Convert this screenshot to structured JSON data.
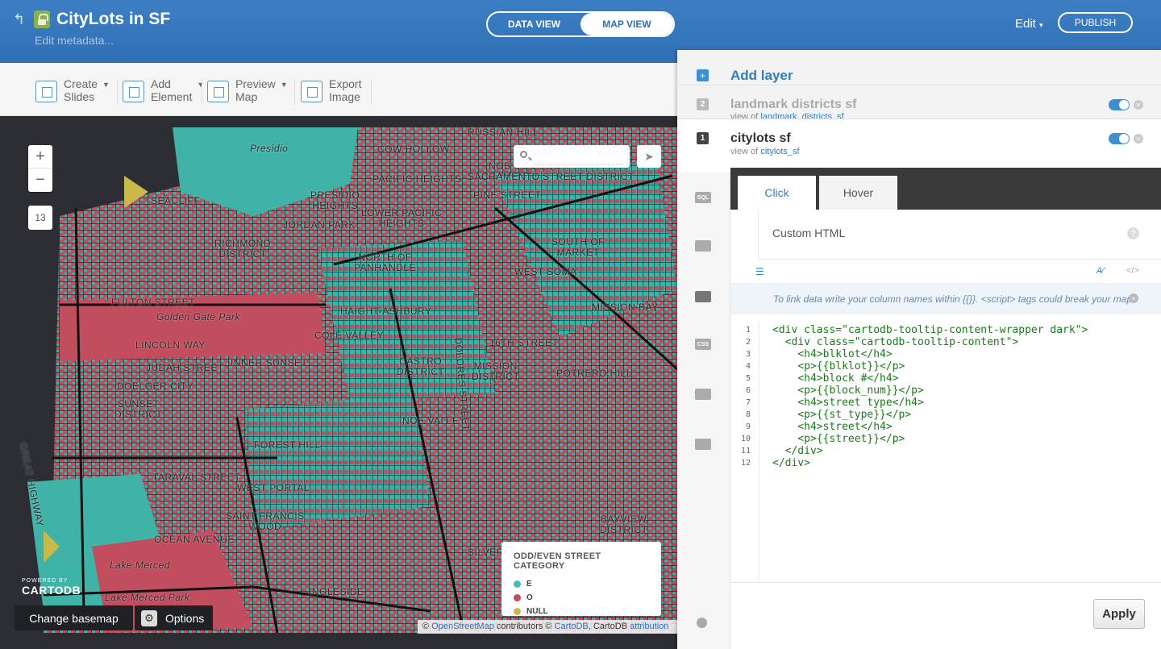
{
  "header": {
    "title": "CityLots in SF",
    "subtitle": "Edit metadata...",
    "data_view": "DATA VIEW",
    "map_view": "MAP VIEW",
    "edit": "Edit",
    "publish": "PUBLISH"
  },
  "toolbar": {
    "items": [
      {
        "line1": "Create",
        "line2": "Slides"
      },
      {
        "line1": "Add",
        "line2": "Element"
      },
      {
        "line1": "Preview",
        "line2": "Map"
      },
      {
        "line1": "Export",
        "line2": "Image"
      }
    ]
  },
  "map": {
    "zoom_in": "+",
    "zoom_out": "−",
    "zoom_level": "13",
    "search_placeholder": "",
    "labels": [
      "RUSSIAN HILL",
      "Presidio",
      "COW HOLLOW",
      "NOB",
      "PACIFIC HEIGHTS",
      "SACRAMENTO STREET DISTRICT",
      "SEACLIFF",
      "PRESIDIO\nHEIGHTS",
      "PINE STREET",
      "LOWER PACIFIC\nHEIGHTS",
      "JORDAN PARK",
      "RICHMOND\nDISTRICT",
      "SOUTH OF\nMARKET",
      "NORTH OF\nPANHANDLE",
      "WEST SOMA",
      "MISSION BAY",
      "FULTON STREET",
      "HAIGHT-ASHBURY",
      "Golden Gate Park",
      "COLE VALLEY",
      "LINCOLN WAY",
      "16TH STREET",
      "CASTRO\nDISTRICT",
      "MISSION\nDISTRICT",
      "INNER SUNSET",
      "JUDAH STREET",
      "POTRERO HILL",
      "DOELGER CITY",
      "SUNSET\nDISTRICT",
      "NOE VALLEY",
      "FOREST HILL",
      "TARAVAL STREET",
      "WEST PORTAL",
      "SAINT FRANCIS\nWOOD",
      "OCEAN AVENUE",
      "BAYVIEW\nDISTRICT",
      "Lake Merced",
      "SILVER",
      "INGLESIDE",
      "Lake Merced Park",
      "GREAT HIGHWAY",
      "DOLORES STREET"
    ],
    "powered_by": "POWERED BY",
    "brand": "CARTODB",
    "change_basemap": "Change basemap",
    "options": "Options",
    "legend": {
      "title": "ODD/EVEN STREET CATEGORY",
      "items": [
        {
          "label": "E",
          "color": "#3cc0b4"
        },
        {
          "label": "O",
          "color": "#c9475a"
        },
        {
          "label": "NULL",
          "color": "#c9b84a"
        }
      ]
    },
    "attribution": {
      "prefix": "©",
      "osm": "OpenStreetMap",
      "mid": "contributors ©",
      "cartodb": "CartoDB",
      "mid2": ", CartoDB",
      "attr": "attribution"
    }
  },
  "panel": {
    "add_layer": "Add layer",
    "layers": [
      {
        "num": "2",
        "name": "landmark districts sf",
        "view_of": "view of",
        "table": "landmark_districts_sf"
      },
      {
        "num": "1",
        "name": "citylots sf",
        "view_of": "view of",
        "table": "citylots_sf"
      }
    ],
    "side_tools": [
      "SQL",
      "",
      "",
      "CSS",
      "",
      ""
    ],
    "tabs": [
      "Click",
      "Hover"
    ],
    "custom_html": "Custom HTML",
    "hint": "To link data write your column names within {{}}. <script> tags could break your map.",
    "code_lines": [
      "<div class=\"cartodb-tooltip-content-wrapper dark\">",
      "  <div class=\"cartodb-tooltip-content\">",
      "    <h4>blklot</h4>",
      "    <p>{{blklot}}</p>",
      "    <h4>block #</h4>",
      "    <p>{{block_num}}</p>",
      "    <h4>street type</h4>",
      "    <p>{{st_type}}</p>",
      "    <h4>street</h4>",
      "    <p>{{street}}</p>",
      "  </div>",
      "</div>"
    ],
    "apply": "Apply"
  }
}
